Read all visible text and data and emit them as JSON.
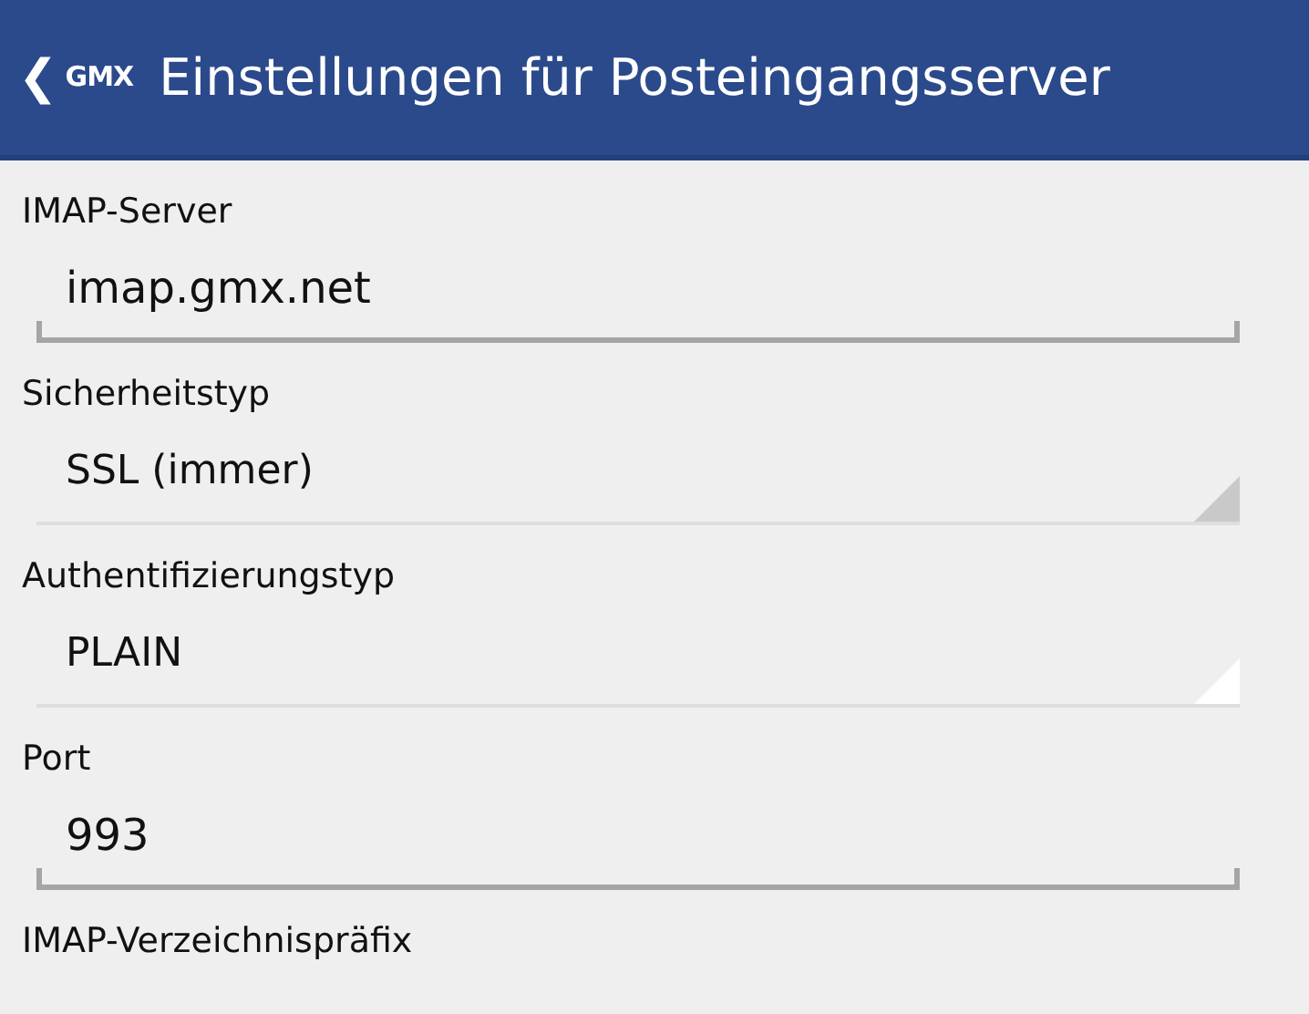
{
  "header": {
    "back": "❮",
    "logo": "GMX",
    "title": "Einstellungen für Posteingangsserver"
  },
  "fields": [
    {
      "label": "IMAP-Server",
      "kind": "text",
      "value": "imap.gmx.net"
    },
    {
      "label": "Sicherheitstyp",
      "kind": "select",
      "value": "SSL (immer)",
      "focused": false
    },
    {
      "label": "Authentifizierungstyp",
      "kind": "select",
      "value": "PLAIN",
      "focused": true
    },
    {
      "label": "Port",
      "kind": "text",
      "value": "993"
    },
    {
      "label": "IMAP-Verzeichnispräfix",
      "kind": "label"
    }
  ]
}
